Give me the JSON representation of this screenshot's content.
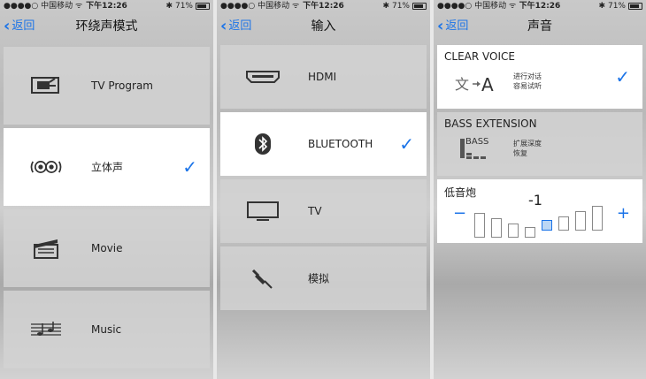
{
  "status": {
    "carrier": "●●●●○ 中国移动 ᯤ",
    "time": "下午12:26",
    "battery": "71%"
  },
  "screen1": {
    "back": "返回",
    "title": "环绕声模式",
    "items": [
      {
        "label": "TV Program",
        "icon": "tv-program-icon",
        "selected": false
      },
      {
        "label": "立体声",
        "icon": "stereo-icon",
        "selected": true
      },
      {
        "label": "Movie",
        "icon": "clapperboard-icon",
        "selected": false
      },
      {
        "label": "Music",
        "icon": "music-score-icon",
        "selected": false
      }
    ]
  },
  "screen2": {
    "back": "返回",
    "title": "输入",
    "items": [
      {
        "label": "HDMI",
        "icon": "hdmi-icon",
        "selected": false
      },
      {
        "label": "BLUETOOTH",
        "icon": "bluetooth-icon",
        "selected": true
      },
      {
        "label": "TV",
        "icon": "tv-icon",
        "selected": false
      },
      {
        "label": "模拟",
        "icon": "analog-plug-icon",
        "selected": false
      }
    ]
  },
  "screen3": {
    "back": "返回",
    "title": "声音",
    "clear_voice": {
      "title": "CLEAR VOICE",
      "sub1": "进行对话",
      "sub2": "容易试听",
      "enabled": true
    },
    "bass_extension": {
      "title": "BASS EXTENSION",
      "icon_text": "BASS",
      "sub1": "扩展深度",
      "sub2": "恢复",
      "enabled": false
    },
    "subwoofer": {
      "title": "低音炮",
      "value": "-1",
      "level_index": 3,
      "levels": 7
    }
  },
  "colors": {
    "accent": "#1a73e8"
  }
}
